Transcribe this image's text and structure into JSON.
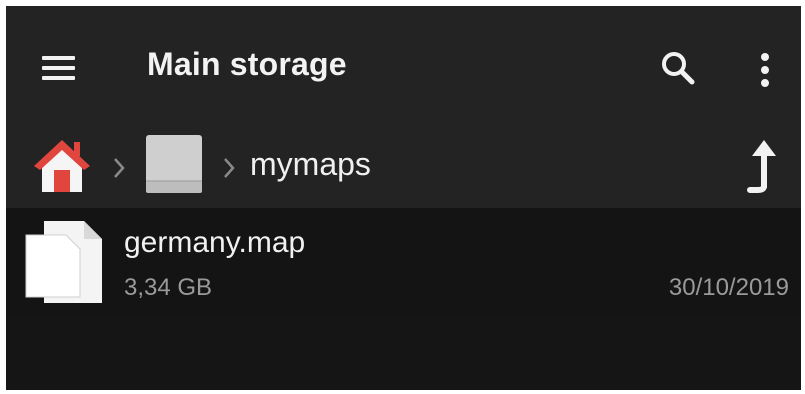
{
  "toolbar": {
    "title": "Main storage",
    "menu_icon": "hamburger-menu-icon",
    "search_icon": "search-icon",
    "more_icon": "more-vert-icon"
  },
  "breadcrumb": {
    "items": [
      {
        "icon": "home-icon"
      },
      {
        "icon": "drive-icon"
      },
      {
        "label": "mymaps"
      }
    ],
    "up_icon": "up-arrow-icon"
  },
  "files": [
    {
      "name": "germany.map",
      "size": "3,34 GB",
      "date": "30/10/2019",
      "icon": "file-icon"
    }
  ],
  "colors": {
    "toolbar_bg": "#232323",
    "list_bg": "#151515",
    "home_roof": "#e0463d",
    "text_primary": "#f1f1f1",
    "text_secondary": "#9a9a9a"
  }
}
